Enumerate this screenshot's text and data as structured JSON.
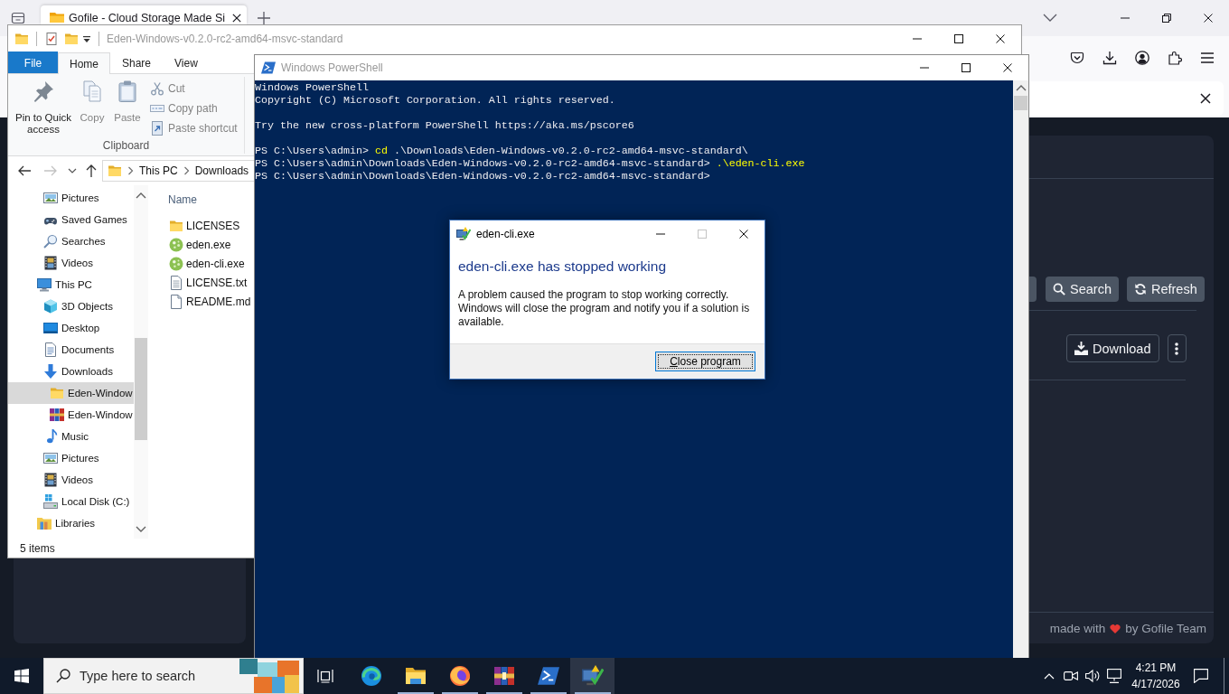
{
  "browser": {
    "tab": {
      "title": "Gofile - Cloud Storage Made Si",
      "selected": true
    },
    "page": {
      "toolbar": [
        {
          "kind": "partial"
        },
        {
          "kind": "search",
          "label": "Search"
        },
        {
          "kind": "refresh",
          "label": "Refresh"
        }
      ],
      "actions": [
        {
          "kind": "download",
          "label": "Download"
        },
        {
          "kind": "more"
        }
      ],
      "footer": {
        "before": "made with",
        "after": "by Gofile Team"
      }
    }
  },
  "explorer": {
    "title": "Eden-Windows-v0.2.0-rc2-amd64-msvc-standard",
    "active": false,
    "ribbon_tabs": [
      {
        "label": "File",
        "kind": "file",
        "selected": false
      },
      {
        "label": "Home",
        "kind": "tab",
        "selected": true
      },
      {
        "label": "Share",
        "kind": "tab",
        "selected": false
      },
      {
        "label": "View",
        "kind": "tab",
        "selected": false
      }
    ],
    "ribbon": {
      "group": "Clipboard",
      "large": [
        {
          "label": "Pin to Quick access",
          "kind": "pin",
          "disabled": false
        },
        {
          "label": "Copy",
          "kind": "copy",
          "disabled": true
        },
        {
          "label": "Paste",
          "kind": "paste",
          "disabled": true
        }
      ],
      "small": [
        {
          "label": "Cut",
          "kind": "cut",
          "disabled": true
        },
        {
          "label": "Copy path",
          "kind": "copy-path",
          "disabled": true
        },
        {
          "label": "Paste shortcut",
          "kind": "paste-shortcut",
          "disabled": true
        }
      ]
    },
    "back": {
      "disabled": false
    },
    "forward": {
      "disabled": true
    },
    "address": [
      "This PC",
      "Downloads"
    ],
    "tree": [
      {
        "children": [
          {
            "label": "Pictures",
            "kind": "pictures",
            "selected": false
          },
          {
            "label": "Saved Games",
            "kind": "games",
            "selected": false
          },
          {
            "label": "Searches",
            "kind": "searches",
            "selected": false
          },
          {
            "label": "Videos",
            "kind": "videos",
            "selected": false
          }
        ]
      },
      {
        "label": "This PC",
        "kind": "pc",
        "selected": false,
        "children": [
          {
            "label": "3D Objects",
            "kind": "objects3d",
            "selected": false
          },
          {
            "label": "Desktop",
            "kind": "desktop",
            "selected": false
          },
          {
            "label": "Documents",
            "kind": "documents",
            "selected": false
          },
          {
            "label": "Downloads",
            "kind": "downloads",
            "selected": false,
            "children": [
              {
                "label": "Eden-Window",
                "kind": "folder",
                "selected": true
              },
              {
                "label": "Eden-Window",
                "kind": "archive",
                "selected": false
              }
            ]
          },
          {
            "label": "Music",
            "kind": "music",
            "selected": false
          },
          {
            "label": "Pictures",
            "kind": "pictures",
            "selected": false
          },
          {
            "label": "Videos",
            "kind": "videos",
            "selected": false
          },
          {
            "label": "Local Disk (C:)",
            "kind": "drive",
            "selected": false
          }
        ]
      },
      {
        "label": "Libraries",
        "kind": "libraries",
        "selected": false
      }
    ],
    "columns": [
      "Name"
    ],
    "files": [
      {
        "name": "LICENSES",
        "kind": "folder"
      },
      {
        "name": "eden.exe",
        "kind": "app"
      },
      {
        "name": "eden-cli.exe",
        "kind": "app"
      },
      {
        "name": "LICENSE.txt",
        "kind": "text"
      },
      {
        "name": "README.md",
        "kind": "file"
      }
    ],
    "status": "5 items"
  },
  "powershell": {
    "title": "Windows PowerShell",
    "active": false,
    "blocks": [
      [
        {
          "kind": "output",
          "text": "Windows PowerShell"
        },
        {
          "kind": "output",
          "text": "Copyright (C) Microsoft Corporation. All rights reserved."
        }
      ],
      [
        {
          "kind": "output",
          "text": "Try the new cross-platform PowerShell https://aka.ms/pscore6"
        }
      ],
      [
        {
          "kind": "prompt",
          "prompt": "PS C:\\Users\\admin>",
          "command": "cd",
          "argument": ".\\Downloads\\Eden-Windows-v0.2.0-rc2-amd64-msvc-standard\\"
        },
        {
          "kind": "prompt",
          "prompt": "PS C:\\Users\\admin\\Downloads\\Eden-Windows-v0.2.0-rc2-amd64-msvc-standard>",
          "command": ".\\eden-cli.exe"
        },
        {
          "kind": "prompt",
          "prompt": "PS C:\\Users\\admin\\Downloads\\Eden-Windows-v0.2.0-rc2-amd64-msvc-standard>"
        }
      ]
    ]
  },
  "dialog": {
    "title": "eden-cli.exe",
    "active": true,
    "maximize_disabled": true,
    "heading": "eden-cli.exe has stopped working",
    "message": "A problem caused the program to stop working correctly. Windows will close the program and notify you if a solution is available.",
    "button": {
      "label": "Close program",
      "focused": true
    }
  },
  "taskbar": {
    "search": {
      "placeholder": "Type here to search"
    },
    "apps": [
      {
        "kind": "edge",
        "running": false,
        "selected": false
      },
      {
        "kind": "explorer",
        "running": true,
        "selected": false
      },
      {
        "kind": "firefox",
        "running": true,
        "selected": false
      },
      {
        "kind": "winrar",
        "running": true,
        "selected": false
      },
      {
        "kind": "powershell",
        "running": true,
        "selected": false
      },
      {
        "kind": "error-reporting",
        "running": true,
        "selected": true
      }
    ],
    "clock": {
      "time": "4:21 PM",
      "date": "4/17/2026"
    }
  }
}
